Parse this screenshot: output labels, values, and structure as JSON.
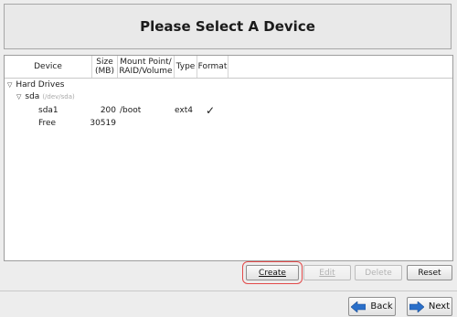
{
  "header": {
    "title": "Please Select A Device"
  },
  "table": {
    "columns": {
      "device": "Device",
      "size_line1": "Size",
      "size_line2": "(MB)",
      "mount_line1": "Mount Point/",
      "mount_line2": "RAID/Volume",
      "type": "Type",
      "format": "Format"
    },
    "tree": {
      "group_label": "Hard Drives",
      "disk_label": "sda",
      "disk_path": "(/dev/sda)",
      "rows": [
        {
          "device": "sda1",
          "size": "200",
          "mount": "/boot",
          "type": "ext4",
          "format": "✓"
        },
        {
          "device": "Free",
          "size": "30519",
          "mount": "",
          "type": "",
          "format": ""
        }
      ]
    }
  },
  "actions": {
    "create_label": "Create",
    "edit_label": "Edit",
    "delete_label": "Delete",
    "reset_label": "Reset"
  },
  "navigation": {
    "back_label": "Back",
    "next_label": "Next"
  },
  "colors": {
    "highlight_box": "#e24a4a",
    "nav_arrow": "#2a6fc9"
  },
  "icons": {
    "expand": "triangle-down-icon",
    "check": "checkmark-icon",
    "back": "left-arrow-icon",
    "next": "right-arrow-icon"
  }
}
